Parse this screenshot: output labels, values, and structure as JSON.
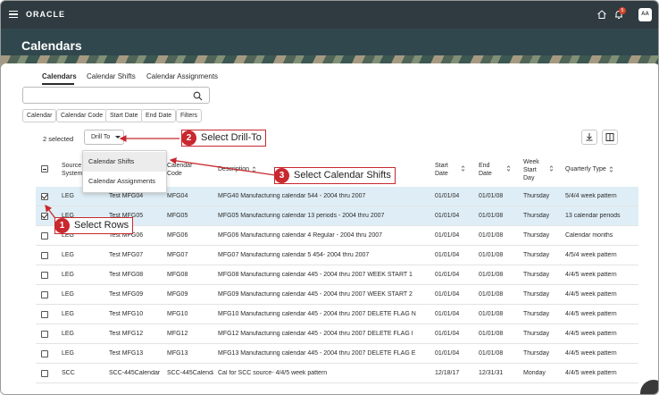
{
  "header": {
    "logo": "ORACLE",
    "notification_count": "5",
    "avatar_initials": "AA"
  },
  "page": {
    "title": "Calendars"
  },
  "tabs": [
    {
      "label": "Calendars",
      "active": true
    },
    {
      "label": "Calendar Shifts",
      "active": false
    },
    {
      "label": "Calendar Assignments",
      "active": false
    }
  ],
  "search": {
    "placeholder": ""
  },
  "filters": [
    "Calendar",
    "Calendar Code",
    "Start Date",
    "End Date",
    "Filters"
  ],
  "toolbar": {
    "selected_count": "2 selected",
    "drill_label": "Drill To"
  },
  "drill_menu": [
    "Calendar Shifts",
    "Calendar Assignments"
  ],
  "columns": {
    "source_system": "Source System",
    "calendar": "Calendar",
    "calendar_code": "Calendar Code",
    "description": "Description",
    "start_date": "Start Date",
    "end_date": "End Date",
    "week_start_day": "Week Start Day",
    "quarterly_type": "Quarterly Type"
  },
  "rows": [
    {
      "selected": true,
      "source": "LEG",
      "calendar": "Test MFG04",
      "code": "MFG04",
      "description": "MFG40 Manufacturing calendar 544 - 2004 thru 2007",
      "start": "01/01/04",
      "end": "01/01/08",
      "day": "Thursday",
      "qtype": "5/4/4 week pattern"
    },
    {
      "selected": true,
      "source": "LEG",
      "calendar": "Test MFG05",
      "code": "MFG05",
      "description": "MFG05 Manufacturing calendar 13 periods - 2004 thru 2007",
      "start": "01/01/04",
      "end": "01/01/08",
      "day": "Thursday",
      "qtype": "13 calendar periods"
    },
    {
      "selected": false,
      "source": "LEG",
      "calendar": "Test MFG06",
      "code": "MFG06",
      "description": "MFG06 Manufacturing calendar 4 Regular - 2004 thru 2007",
      "start": "01/01/04",
      "end": "01/01/08",
      "day": "Thursday",
      "qtype": "Calendar months"
    },
    {
      "selected": false,
      "source": "LEG",
      "calendar": "Test MFG07",
      "code": "MFG07",
      "description": "MFG07 Manufacturing calendar 5 454- 2004 thru 2007",
      "start": "01/01/04",
      "end": "01/01/08",
      "day": "Thursday",
      "qtype": "4/5/4 week pattern"
    },
    {
      "selected": false,
      "source": "LEG",
      "calendar": "Test MFG08",
      "code": "MFG08",
      "description": "MFG08 Manufacturing calendar 445 - 2004 thru 2007 WEEK START 1",
      "start": "01/01/04",
      "end": "01/01/08",
      "day": "Thursday",
      "qtype": "4/4/5 week pattern"
    },
    {
      "selected": false,
      "source": "LEG",
      "calendar": "Test MFG09",
      "code": "MFG09",
      "description": "MFG09 Manufacturing calendar 445 - 2004 thru 2007 WEEK START 2",
      "start": "01/01/04",
      "end": "01/01/08",
      "day": "Thursday",
      "qtype": "4/4/5 week pattern"
    },
    {
      "selected": false,
      "source": "LEG",
      "calendar": "Test MFG10",
      "code": "MFG10",
      "description": "MFG10 Manufacturing calendar 445 - 2004 thru 2007 DELETE FLAG N",
      "start": "01/01/04",
      "end": "01/01/08",
      "day": "Thursday",
      "qtype": "4/4/5 week pattern"
    },
    {
      "selected": false,
      "source": "LEG",
      "calendar": "Test MFG12",
      "code": "MFG12",
      "description": "MFG12 Manufacturing calendar 445 - 2004 thru 2007 DELETE FLAG I",
      "start": "01/01/04",
      "end": "01/01/08",
      "day": "Thursday",
      "qtype": "4/4/5 week pattern"
    },
    {
      "selected": false,
      "source": "LEG",
      "calendar": "Test MFG13",
      "code": "MFG13",
      "description": "MFG13 Manufacturing calendar 445 - 2004 thru 2007 DELETE FLAG E",
      "start": "01/01/04",
      "end": "01/01/08",
      "day": "Thursday",
      "qtype": "4/4/5 week pattern"
    },
    {
      "selected": false,
      "source": "SCC",
      "calendar": "SCC-445Calendar",
      "code": "SCC-445Calendar",
      "description": "Cal for SCC source- 4/4/5 week pattern",
      "start": "12/18/17",
      "end": "12/31/31",
      "day": "Monday",
      "qtype": "4/4/5 week pattern"
    }
  ],
  "callouts": [
    {
      "num": "1",
      "text": "Select Rows"
    },
    {
      "num": "2",
      "text": "Select Drill-To"
    },
    {
      "num": "3",
      "text": "Select Calendar Shifts"
    }
  ],
  "colors": {
    "topbar": "#2f3b40",
    "hero": "#31474e",
    "selected_row": "#dfeef6",
    "callout": "#c8282e"
  }
}
